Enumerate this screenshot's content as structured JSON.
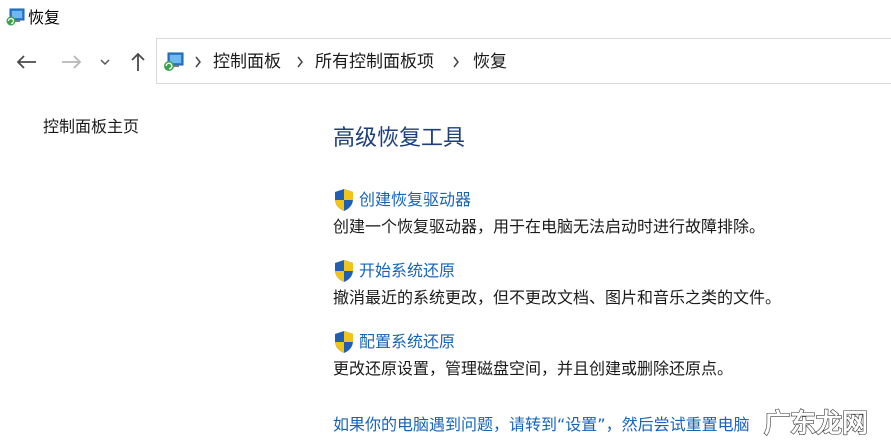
{
  "window": {
    "title": "恢复"
  },
  "nav": {
    "breadcrumb": [
      "控制面板",
      "所有控制面板项",
      "恢复"
    ]
  },
  "sidebar": {
    "home_link": "控制面板主页"
  },
  "main": {
    "heading": "高级恢复工具",
    "tasks": [
      {
        "link": "创建恢复驱动器",
        "desc": "创建一个恢复驱动器，用于在电脑无法启动时进行故障排除。"
      },
      {
        "link": "开始系统还原",
        "desc": "撤消最近的系统更改，但不更改文档、图片和音乐之类的文件。"
      },
      {
        "link": "配置系统还原",
        "desc": "更改还原设置，管理磁盘空间，并且创建或删除还原点。"
      }
    ],
    "bottom_link": "如果你的电脑遇到问题，请转到“设置”，然后尝试重置电脑"
  },
  "watermark": {
    "text": "广东龙网"
  },
  "colors": {
    "link": "#1664b8",
    "heading": "#1d3f7a",
    "text": "#1a1a1a"
  }
}
